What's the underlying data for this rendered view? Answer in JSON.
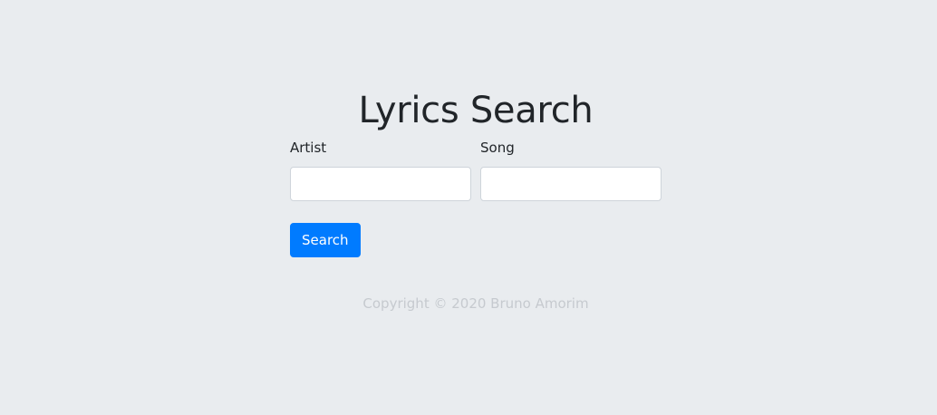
{
  "page": {
    "title": "Lyrics Search"
  },
  "form": {
    "artist_label": "Artist",
    "artist_value": "",
    "song_label": "Song",
    "song_value": "",
    "search_label": "Search"
  },
  "footer": {
    "copyright": "Copyright © 2020 Bruno Amorim"
  },
  "colors": {
    "background": "#e9ecef",
    "primary": "#007bff",
    "footer_text": "#c6cacf"
  }
}
